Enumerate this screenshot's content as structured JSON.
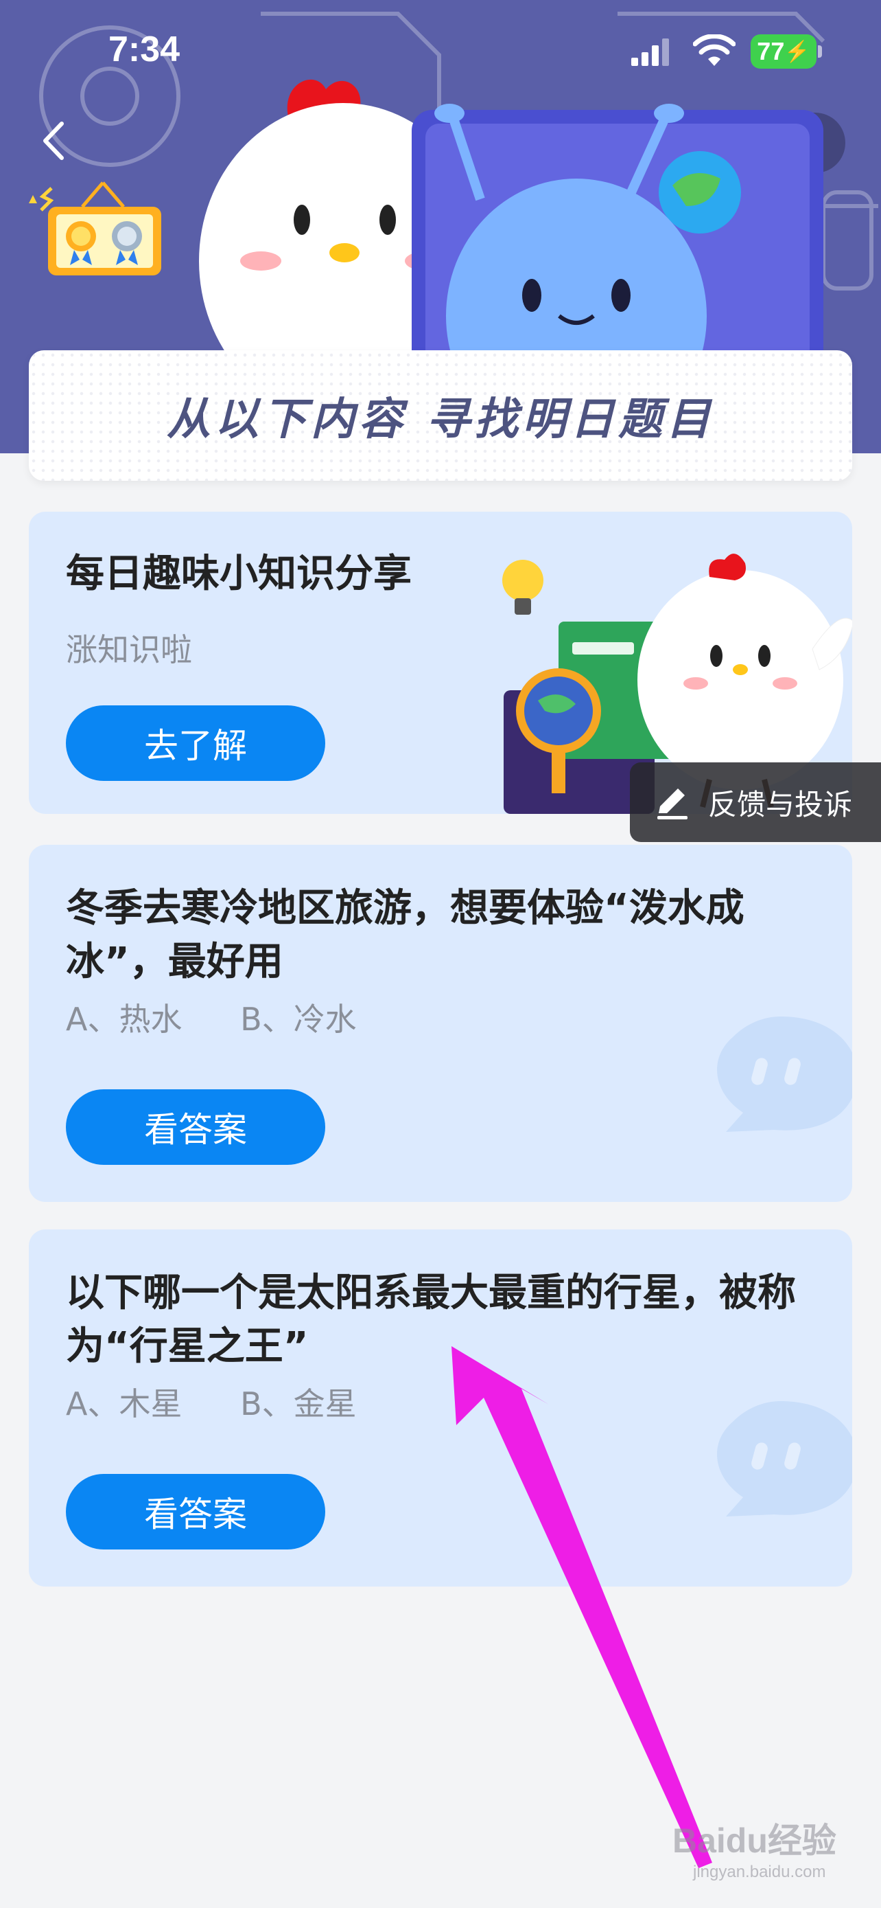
{
  "status_bar": {
    "time": "7:34",
    "battery": "77"
  },
  "banner": {
    "title": "从以下内容  寻找明日题目"
  },
  "cards": [
    {
      "title": "每日趣味小知识分享",
      "subtitle": "涨知识啦",
      "button": "去了解"
    },
    {
      "title": "冬季去寒冷地区旅游，想要体验“泼水成冰”，最好用",
      "options": [
        "A、热水",
        "B、冷水"
      ],
      "button": "看答案"
    },
    {
      "title": "以下哪一个是太阳系最大最重的行星，被称为“行星之王”",
      "options": [
        "A、木星",
        "B、金星"
      ],
      "button": "看答案"
    }
  ],
  "feedback": {
    "label": "反馈与投诉"
  },
  "watermark": {
    "brand": "Baidu经验",
    "url": "jingyan.baidu.com"
  },
  "colors": {
    "header_bg": "#5a5fa8",
    "card_bg": "#dceafe",
    "button_bg": "#0a86f3",
    "annotation_arrow": "#ee1ee6"
  }
}
